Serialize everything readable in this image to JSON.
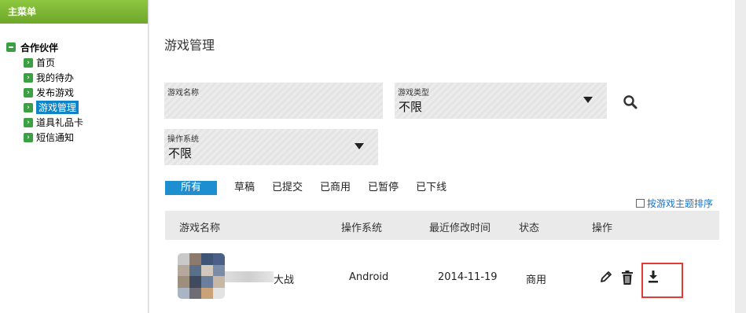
{
  "sidebar": {
    "header": "主菜单",
    "group": "合作伙伴",
    "items": [
      {
        "label": "首页",
        "active": false
      },
      {
        "label": "我的待办",
        "active": false
      },
      {
        "label": "发布游戏",
        "active": false
      },
      {
        "label": "游戏管理",
        "active": true
      },
      {
        "label": "道具礼品卡",
        "active": false
      },
      {
        "label": "短信通知",
        "active": false
      }
    ]
  },
  "page": {
    "title": "游戏管理"
  },
  "filters": {
    "game_name_label": "游戏名称",
    "game_name_value": "",
    "game_type_label": "游戏类型",
    "game_type_value": "不限",
    "os_label": "操作系统",
    "os_value": "不限"
  },
  "tabs": [
    "所有",
    "草稿",
    "已提交",
    "已商用",
    "已暂停",
    "已下线"
  ],
  "active_tab": 0,
  "sort_option": "按游戏主题排序",
  "table": {
    "headers": [
      "游戏名称",
      "操作系统",
      "最近修改时间",
      "状态",
      "操作"
    ],
    "rows": [
      {
        "name": "大战",
        "os": "Android",
        "modified": "2014-11-19",
        "status": "商用"
      }
    ]
  },
  "colors": {
    "sidebar_header": "#7ab636",
    "tree_icon": "#3aa042",
    "active_item": "#0d84c8",
    "active_tab": "#1d8fd0",
    "link": "#1a73c8",
    "highlight": "#e53935"
  },
  "icons": [
    "minus-icon",
    "arrow-right-icon",
    "search-icon",
    "caret-down-icon",
    "edit-icon",
    "trash-icon",
    "download-icon"
  ]
}
